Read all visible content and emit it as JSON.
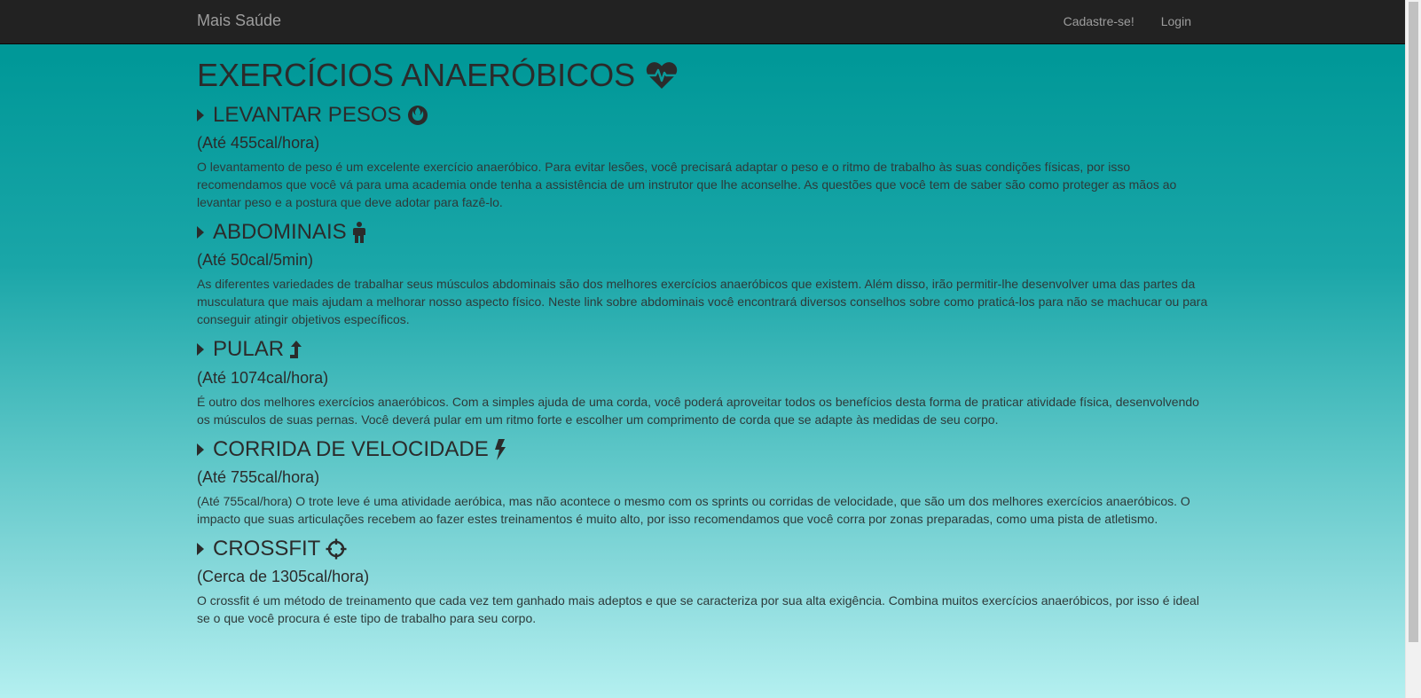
{
  "nav": {
    "brand": "Mais Saúde",
    "links": [
      "Cadastre-se!",
      "Login"
    ]
  },
  "page": {
    "title": "EXERCÍCIOS ANAERÓBICOS",
    "title_icon": "heartbeat-icon"
  },
  "sections": [
    {
      "title": "LEVANTAR PESOS",
      "icon": "rebel-icon",
      "subtitle": "(Até 455cal/hora)",
      "text": "O levantamento de peso é um excelente exercício anaeróbico. Para evitar lesões, você precisará adaptar o peso e o ritmo de trabalho às suas condições físicas, por isso recomendamos que você vá para uma academia onde tenha a assistência de um instrutor que lhe aconselhe. As questões que você tem de saber são como proteger as mãos ao levantar peso e a postura que deve adotar para fazê-lo."
    },
    {
      "title": "ABDOMINAIS",
      "icon": "male-figure-icon",
      "subtitle": "(Até 50cal/5min)",
      "text": "As diferentes variedades de trabalhar seus músculos abdominais são dos melhores exercícios anaeróbicos que existem. Além disso, irão permitir-lhe desenvolver uma das partes da musculatura que mais ajudam a melhorar nosso aspecto físico. Neste link sobre abdominais você encontrará diversos conselhos sobre como praticá-los para não se machucar ou para conseguir atingir objetivos específicos."
    },
    {
      "title": "PULAR",
      "icon": "level-up-icon",
      "subtitle": "(Até 1074cal/hora)",
      "text": "É outro dos melhores exercícios anaeróbicos. Com a simples ajuda de uma corda, você poderá aproveitar todos os benefícios desta forma de praticar atividade física, desenvolvendo os músculos de suas pernas. Você deverá pular em um ritmo forte e escolher um comprimento de corda que se adapte às medidas de seu corpo."
    },
    {
      "title": "CORRIDA DE VELOCIDADE",
      "icon": "bolt-icon",
      "subtitle": "(Até 755cal/hora)",
      "text": "(Até 755cal/hora) O trote leve é uma atividade aeróbica, mas não acontece o mesmo com os sprints ou corridas de velocidade, que são um dos melhores exercícios anaeróbicos. O impacto que suas articulações recebem ao fazer estes treinamentos é muito alto, por isso recomendamos que você corra por zonas preparadas, como uma pista de atletismo."
    },
    {
      "title": "CROSSFIT",
      "icon": "crosshairs-icon",
      "subtitle": "(Cerca de 1305cal/hora)",
      "text": "O crossfit é um método de treinamento que cada vez tem ganhado mais adeptos e que se caracteriza por sua alta exigência. Combina muitos exercícios anaeróbicos, por isso é ideal se o que você procura é este tipo de trabalho para seu corpo."
    }
  ],
  "colors": {
    "navbar_bg": "#222222",
    "nav_text": "#9d9d9d",
    "text": "#2b2b2b",
    "gradient_top": "#009b9b",
    "gradient_bottom": "#b4f0f0"
  }
}
